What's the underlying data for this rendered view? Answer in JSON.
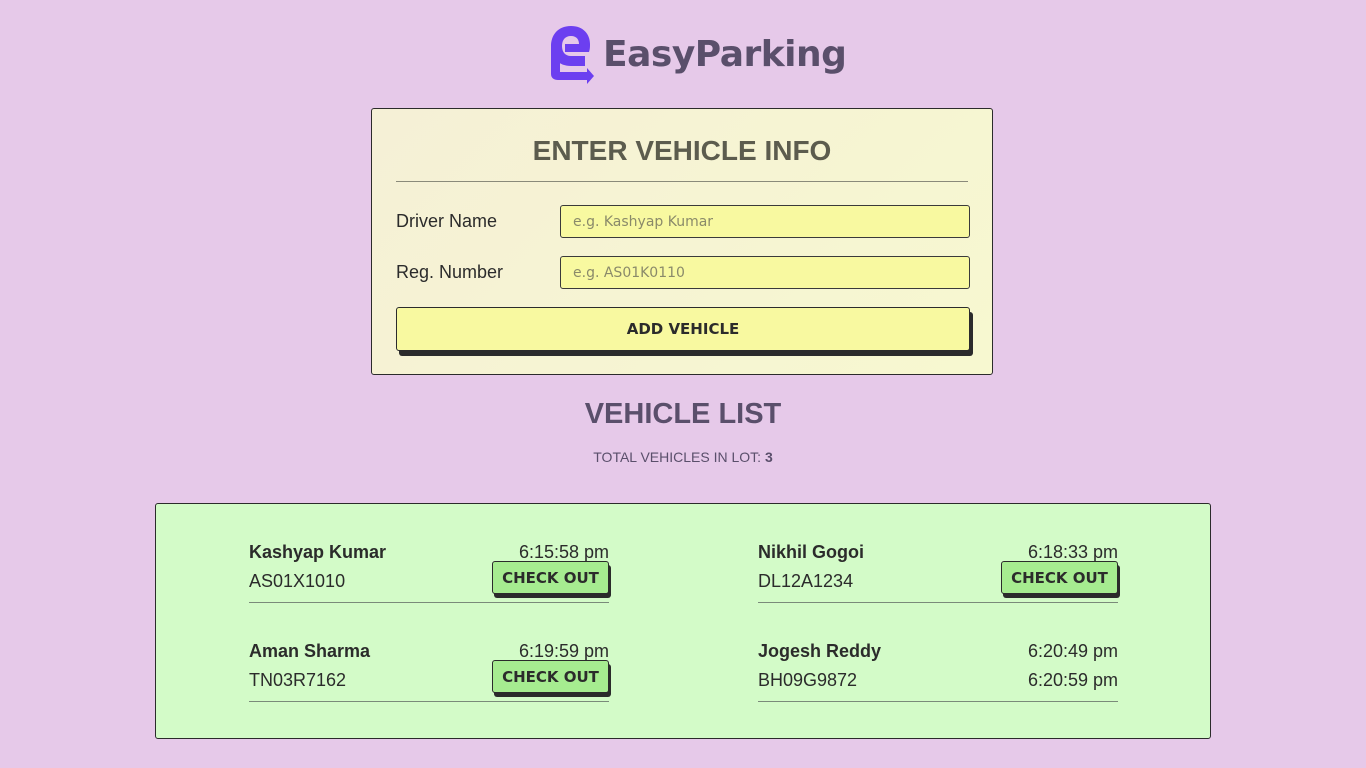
{
  "brand": {
    "name": "EasyParking",
    "logo_icon": "easyparking-logo-icon",
    "accent": "#6c3ff0"
  },
  "form": {
    "title": "ENTER VEHICLE INFO",
    "driver_label": "Driver Name",
    "driver_placeholder": "e.g. Kashyap Kumar",
    "driver_value": "",
    "reg_label": "Reg. Number",
    "reg_placeholder": "e.g. AS01K0110",
    "reg_value": "",
    "submit_label": "ADD VEHICLE"
  },
  "list": {
    "title": "VEHICLE LIST",
    "count_label": "TOTAL VEHICLES IN LOT: ",
    "count": "3",
    "checkout_label": "CHECK OUT",
    "vehicles": [
      {
        "name": "Kashyap Kumar",
        "reg": "AS01X1010",
        "time_in": "6:15:58 pm",
        "time_out": null
      },
      {
        "name": "Nikhil Gogoi",
        "reg": "DL12A1234",
        "time_in": "6:18:33 pm",
        "time_out": null
      },
      {
        "name": "Aman Sharma",
        "reg": "TN03R7162",
        "time_in": "6:19:59 pm",
        "time_out": null
      },
      {
        "name": "Jogesh Reddy",
        "reg": "BH09G9872",
        "time_in": "6:20:49 pm",
        "time_out": "6:20:59 pm"
      }
    ]
  },
  "colors": {
    "background": "#e6c9e9",
    "form_bg": "#f7f8d0",
    "input_bg": "#f8f9a0",
    "list_bg": "#d3fbc8",
    "checkout_bg": "#a6ec90",
    "title_color": "#5a4f6b"
  }
}
